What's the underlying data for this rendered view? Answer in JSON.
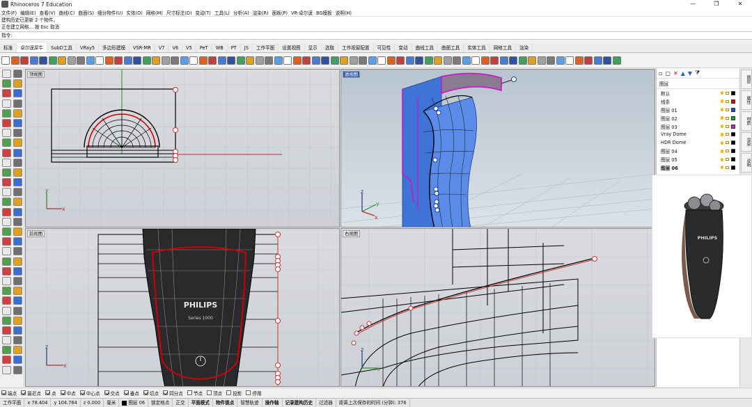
{
  "window": {
    "title": "Rhinoceros 7 Education",
    "controls": [
      "—",
      "❐",
      "✕"
    ]
  },
  "menu": [
    "文件(F)",
    "编辑(E)",
    "查看(V)",
    "曲线(C)",
    "曲面(S)",
    "细分物件(U)",
    "实体(O)",
    "网格(M)",
    "尺寸标注(D)",
    "变动(T)",
    "工具(L)",
    "分析(A)",
    "渲染(R)",
    "面板(P)",
    "VR-卓尔谟",
    "BG模板",
    "说明(H)"
  ],
  "command": {
    "history": [
      "建构历史已更新 2 个物件。",
      "正在建立网格... 按 Esc 取消"
    ],
    "prompt": "指令:"
  },
  "toolbar_tabs": [
    "标准",
    "卓尔谟犀牛",
    "SubD工具",
    "VRay5",
    "多边形建模",
    "VSR-MR",
    "V7",
    "V6",
    "V5",
    "PeT",
    "WB",
    "PT",
    "JS",
    "工作平面",
    "设置视图",
    "显示",
    "选取",
    "工作视窗配置",
    "可见性",
    "变动",
    "曲线工具",
    "曲面工具",
    "实体工具",
    "网格工具",
    "渲染"
  ],
  "active_tab": "卓尔谟犀牛",
  "viewports": {
    "top": {
      "label": "顶视图",
      "axis_x": "x",
      "axis_y": "y"
    },
    "perspective": {
      "label": "透视图",
      "axis_x": "x",
      "axis_y": "y",
      "axis_z": "z"
    },
    "front": {
      "label": "前视图",
      "axis_x": "x",
      "axis_y": "z",
      "brand": "PHILIPS",
      "series": "Series 1000"
    },
    "right": {
      "label": "右视图",
      "axis_x": "y",
      "axis_y": "z"
    }
  },
  "layers": {
    "header": "图层",
    "items": [
      {
        "name": "默认",
        "color": "#000000"
      },
      {
        "name": "线条",
        "color": "#e00000"
      },
      {
        "name": "图层 01",
        "color": "#1a4fd8"
      },
      {
        "name": "图层 02",
        "color": "#1aa61a"
      },
      {
        "name": "图层 03",
        "color": "#d81ab8"
      },
      {
        "name": "Vray Dome",
        "color": "#000000"
      },
      {
        "name": "HDR Dome",
        "color": "#000000"
      },
      {
        "name": "图层 04",
        "color": "#000000"
      },
      {
        "name": "图层 05",
        "color": "#000000"
      },
      {
        "name": "图层 06",
        "color": "#000000"
      }
    ]
  },
  "side_tabs": [
    "图层",
    "属性",
    "材质",
    "渲染",
    "说明"
  ],
  "reference_product": {
    "brand": "PHILIPS"
  },
  "osnaps": [
    {
      "label": "端点",
      "on": true
    },
    {
      "label": "最近点",
      "on": true
    },
    {
      "label": "点",
      "on": true
    },
    {
      "label": "中点",
      "on": true
    },
    {
      "label": "中心点",
      "on": true
    },
    {
      "label": "交点",
      "on": true
    },
    {
      "label": "垂点",
      "on": true
    },
    {
      "label": "切点",
      "on": true
    },
    {
      "label": "四分点",
      "on": true
    },
    {
      "label": "节点",
      "on": false
    },
    {
      "label": "顶点",
      "on": false
    },
    {
      "label": "投影",
      "on": false
    },
    {
      "label": "停用",
      "on": false
    }
  ],
  "status": {
    "cplane": "工作平面",
    "x": "x 78.404",
    "y": "y 104.764",
    "z": "z 0.000",
    "unit": "毫米",
    "layer": "图层 06",
    "toggles": [
      "锁定格点",
      "正交",
      "平面模式",
      "物件锁点",
      "智慧轨迹",
      "操作轴",
      "记录建构历史",
      "过滤器"
    ],
    "autosave": "距离上次保存的时间 (分钟): 376"
  }
}
